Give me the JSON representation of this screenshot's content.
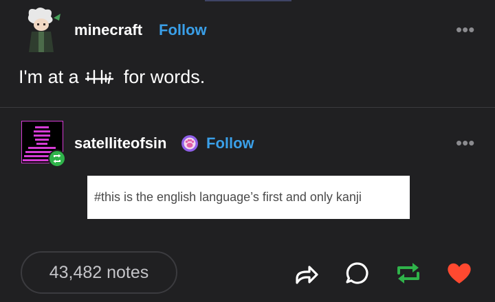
{
  "post1": {
    "username": "minecraft",
    "follow_label": "Follow",
    "body_before": "I'm at a",
    "body_after": "for words.",
    "more_label": "•••"
  },
  "post2": {
    "username": "satelliteofsin",
    "follow_label": "Follow",
    "more_label": "•••",
    "tag": "#this is the english language’s first and only kanji"
  },
  "footer": {
    "notes_label": "43,482 notes"
  },
  "icons": {
    "share": "share-icon",
    "reply": "reply-icon",
    "reblog": "reblog-icon",
    "like": "heart-icon"
  },
  "colors": {
    "background": "#202022",
    "follow": "#3a9fe8",
    "reblog": "#2fb34a",
    "like": "#ff4930",
    "avatar_accent": "#d63cd6"
  }
}
